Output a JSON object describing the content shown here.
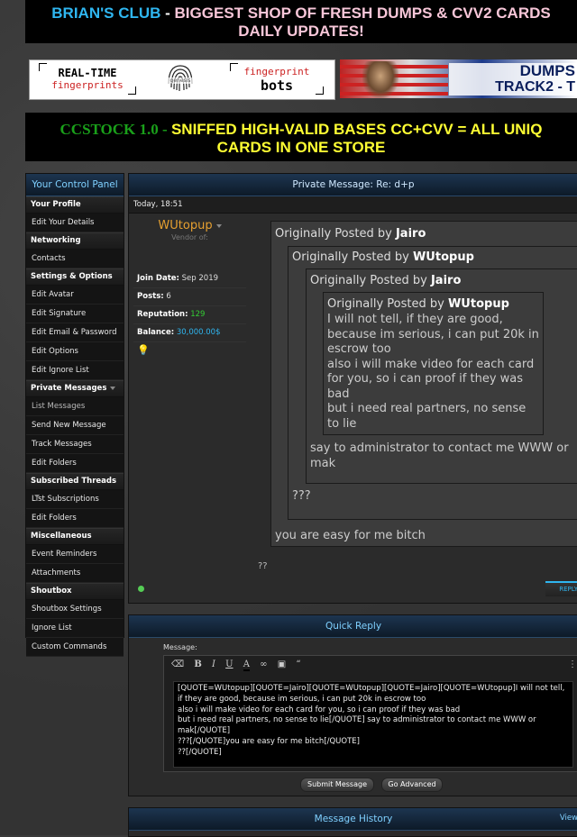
{
  "top_banner": {
    "part1": "BRIAN'S CLUB",
    "sep": " - ",
    "part2": "BIGGEST SHOP OF FRESH DUMPS & CVV2 CARDS",
    "line2": "DAILY UPDATES!"
  },
  "ad_left": {
    "box1_line1": "REAL-TIME",
    "box1_line2": "fingerprints",
    "logo": "genesis",
    "box2_line1": "fingerprint",
    "box2_line2": "bots"
  },
  "ad_right": {
    "line1": "DUMPS",
    "line2": "TRACK2 - T"
  },
  "ccstock_banner": {
    "part1": "CCSTOCK 1.0 - ",
    "part2": "SNIFFED HIGH-VALID BASES CC+CVV = ALL UNIQ",
    "line2": "CARDS IN ONE STORE"
  },
  "sidebar": {
    "title": "Your Control Panel",
    "sections": [
      {
        "label": "Your Profile",
        "items": [
          "Edit Your Details"
        ]
      },
      {
        "label": "Networking",
        "items": [
          "Contacts"
        ]
      },
      {
        "label": "Settings & Options",
        "items": [
          "Edit Avatar",
          "Edit Signature",
          "Edit Email & Password",
          "Edit Options",
          "Edit Ignore List"
        ]
      },
      {
        "label": "Private Messages",
        "items": [
          "List Messages",
          "Send New Message",
          "Track Messages",
          "Edit Folders"
        ]
      },
      {
        "label": "Subscribed Threads",
        "items": [
          "List Subscriptions",
          "Edit Folders"
        ]
      },
      {
        "label": "Miscellaneous",
        "items": [
          "Event Reminders",
          "Attachments"
        ]
      },
      {
        "label": "Shoutbox",
        "items": [
          "Shoutbox Settings",
          "Ignore List",
          "Custom Commands"
        ]
      }
    ]
  },
  "post": {
    "panel_title": "Private Message: Re: d+p",
    "timestamp": "Today, 18:51",
    "username": "WUtopup",
    "user_title": "Vendor of:",
    "join_label": "Join Date:",
    "join_value": "Sep 2019",
    "posts_label": "Posts:",
    "posts_value": "6",
    "rep_label": "Reputation:",
    "rep_value": "129",
    "balance_label": "Balance:",
    "balance_value": "30,000.00$",
    "q_prefix": "Originally Posted by ",
    "q1_author": "Jairo",
    "q2_author": "WUtopup",
    "q3_author": "Jairo",
    "q4_author": "WUtopup",
    "q4_text": "I will not tell, if they are good, because im serious, i can put 20k in escrow too\nalso i will make video for each card for you, so i can proof if they was bad\nbut i need real partners, no sense to lie",
    "q3_text": "say to administrator to contact me WWW or mak",
    "q2_text": "???",
    "q1_text": "you are easy for me bitch",
    "post_text": "??",
    "reply_label": "REPLY"
  },
  "quick_reply": {
    "title": "Quick Reply",
    "message_label": "Message:",
    "textarea": "[QUOTE=WUtopup][QUOTE=Jairo][QUOTE=WUtopup][QUOTE=Jairo][QUOTE=WUtopup]I will not tell, if they are good, because im serious, i can put 20k in escrow too\nalso i will make video for each card for you, so i can proof if they was bad\nbut i need real partners, no sense to lie[/QUOTE] say to administrator to contact me WWW or mak[/QUOTE]\n???[/QUOTE]you are easy for me bitch[/QUOTE]\n??[/QUOTE]",
    "submit_label": "Submit Message",
    "advanced_label": "Go Advanced"
  },
  "history": {
    "title": "Message History",
    "view_label": "View"
  },
  "colors": {
    "accent": "#2fb6f0",
    "username": "#e6a030",
    "rep": "#33cc33"
  }
}
